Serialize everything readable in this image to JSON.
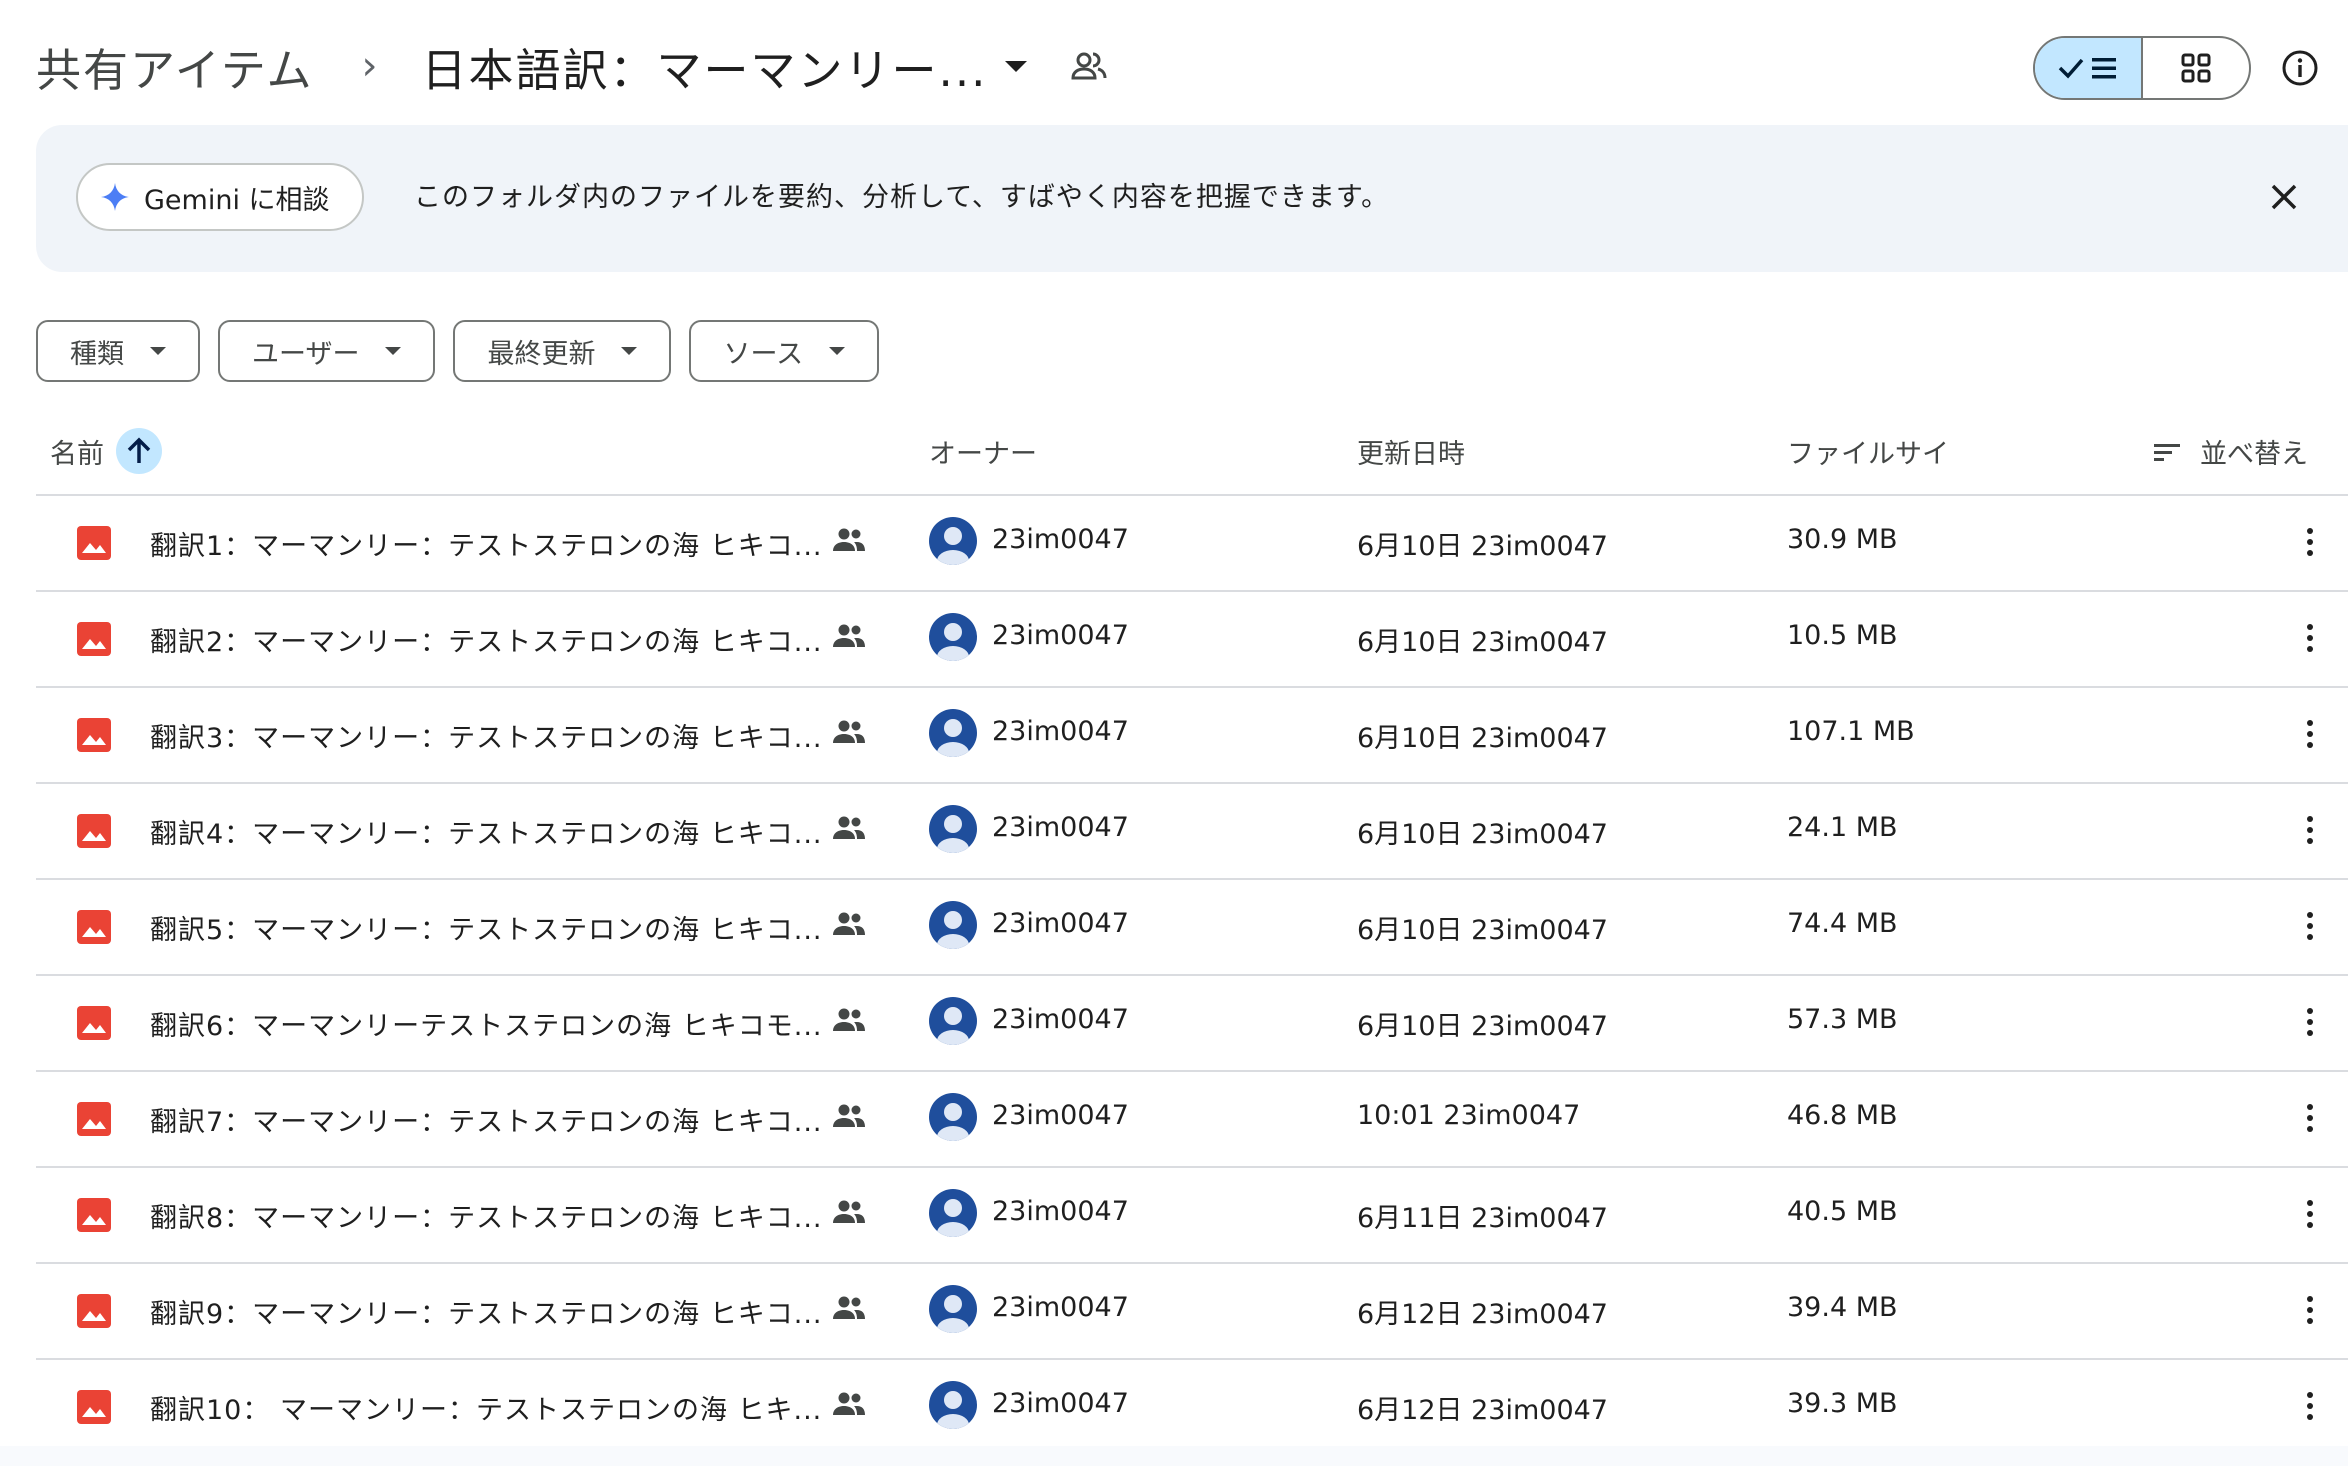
{
  "breadcrumb": {
    "root": "共有アイテム",
    "separator": "›",
    "current": "日本語訳：マーマンリー..."
  },
  "banner": {
    "gemini_label": "Gemini に相談",
    "text": "このフォルダ内のファイルを要約、分析して、すばやく内容を把握できます。"
  },
  "filters": [
    "種類",
    "ユーザー",
    "最終更新",
    "ソース"
  ],
  "columns": {
    "name": "名前",
    "owner": "オーナー",
    "modified": "更新日時",
    "size": "ファイルサイ",
    "sort": "並べ替え"
  },
  "files": [
    {
      "name": "翻訳1：マーマンリー：テストステロンの海 ヒキコ...",
      "owner": "23im0047",
      "modified": "6月10日 23im0047",
      "size": "30.9 MB"
    },
    {
      "name": "翻訳2：マーマンリー：テストステロンの海 ヒキコ...",
      "owner": "23im0047",
      "modified": "6月10日 23im0047",
      "size": "10.5 MB"
    },
    {
      "name": "翻訳3：マーマンリー：テストステロンの海 ヒキコ...",
      "owner": "23im0047",
      "modified": "6月10日 23im0047",
      "size": "107.1 MB"
    },
    {
      "name": "翻訳4：マーマンリー：テストステロンの海 ヒキコ...",
      "owner": "23im0047",
      "modified": "6月10日 23im0047",
      "size": "24.1 MB"
    },
    {
      "name": "翻訳5：マーマンリー：テストステロンの海 ヒキコ...",
      "owner": "23im0047",
      "modified": "6月10日 23im0047",
      "size": "74.4 MB"
    },
    {
      "name": "翻訳6：マーマンリーテストステロンの海 ヒキコモ...",
      "owner": "23im0047",
      "modified": "6月10日 23im0047",
      "size": "57.3 MB"
    },
    {
      "name": "翻訳7：マーマンリー：テストステロンの海 ヒキコ...",
      "owner": "23im0047",
      "modified": "10:01 23im0047",
      "size": "46.8 MB"
    },
    {
      "name": "翻訳8：マーマンリー：テストステロンの海 ヒキコ...",
      "owner": "23im0047",
      "modified": "6月11日 23im0047",
      "size": "40.5 MB"
    },
    {
      "name": "翻訳9：マーマンリー：テストステロンの海 ヒキコ...",
      "owner": "23im0047",
      "modified": "6月12日 23im0047",
      "size": "39.4 MB"
    },
    {
      "name": "翻訳10： マーマンリー：テストステロンの海 ヒキ...",
      "owner": "23im0047",
      "modified": "6月12日 23im0047",
      "size": "39.3 MB"
    }
  ],
  "colors": {
    "image_icon": "#ea4335",
    "accent": "#c2e7ff",
    "avatar": "#1f4e9c"
  }
}
